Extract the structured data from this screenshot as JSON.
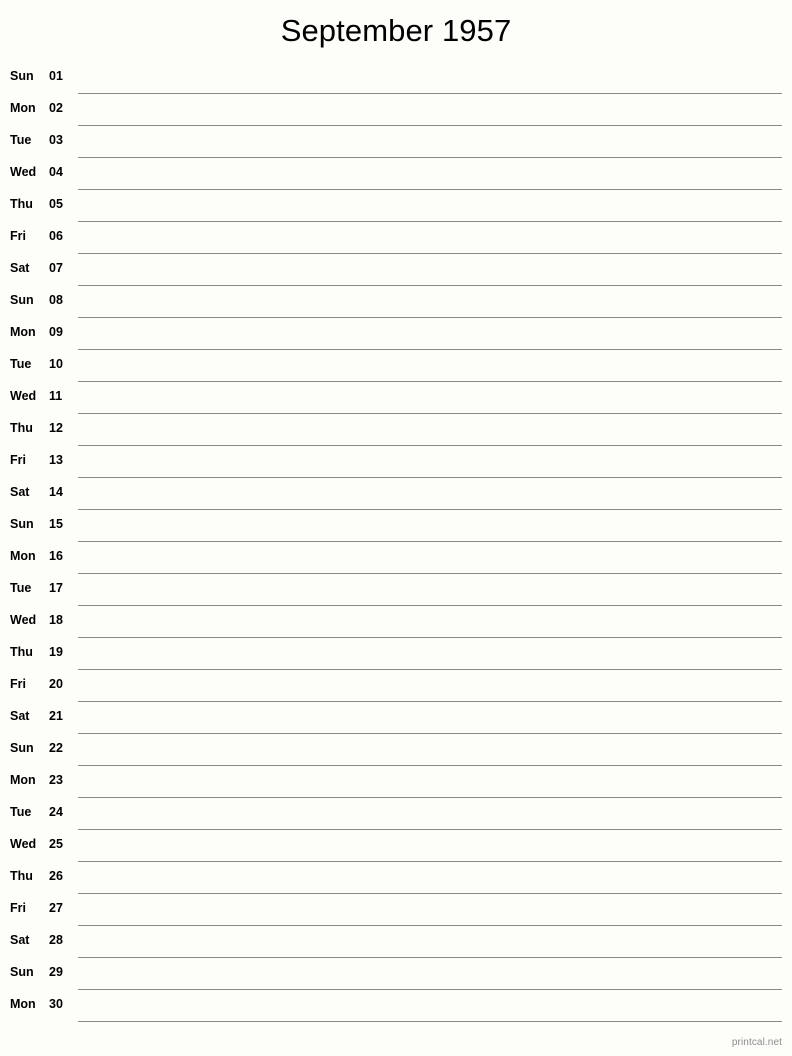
{
  "document": {
    "title": "September 1957",
    "month": "September",
    "year": "1957",
    "type": "single-column-notes-calendar",
    "background_color": "#fdfdfa",
    "rule_line_color": "#8a8a8a",
    "text_color": "#000000"
  },
  "footer": {
    "credit": "printcal.net",
    "color": "#8c8c8c"
  },
  "days": [
    {
      "weekday": "Sun",
      "number": "01"
    },
    {
      "weekday": "Mon",
      "number": "02"
    },
    {
      "weekday": "Tue",
      "number": "03"
    },
    {
      "weekday": "Wed",
      "number": "04"
    },
    {
      "weekday": "Thu",
      "number": "05"
    },
    {
      "weekday": "Fri",
      "number": "06"
    },
    {
      "weekday": "Sat",
      "number": "07"
    },
    {
      "weekday": "Sun",
      "number": "08"
    },
    {
      "weekday": "Mon",
      "number": "09"
    },
    {
      "weekday": "Tue",
      "number": "10"
    },
    {
      "weekday": "Wed",
      "number": "11"
    },
    {
      "weekday": "Thu",
      "number": "12"
    },
    {
      "weekday": "Fri",
      "number": "13"
    },
    {
      "weekday": "Sat",
      "number": "14"
    },
    {
      "weekday": "Sun",
      "number": "15"
    },
    {
      "weekday": "Mon",
      "number": "16"
    },
    {
      "weekday": "Tue",
      "number": "17"
    },
    {
      "weekday": "Wed",
      "number": "18"
    },
    {
      "weekday": "Thu",
      "number": "19"
    },
    {
      "weekday": "Fri",
      "number": "20"
    },
    {
      "weekday": "Sat",
      "number": "21"
    },
    {
      "weekday": "Sun",
      "number": "22"
    },
    {
      "weekday": "Mon",
      "number": "23"
    },
    {
      "weekday": "Tue",
      "number": "24"
    },
    {
      "weekday": "Wed",
      "number": "25"
    },
    {
      "weekday": "Thu",
      "number": "26"
    },
    {
      "weekday": "Fri",
      "number": "27"
    },
    {
      "weekday": "Sat",
      "number": "28"
    },
    {
      "weekday": "Sun",
      "number": "29"
    },
    {
      "weekday": "Mon",
      "number": "30"
    }
  ]
}
